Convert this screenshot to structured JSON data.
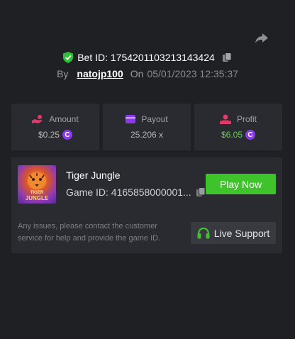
{
  "bet": {
    "id_text": "Bet ID: 1754201103213143424",
    "by_label": "By",
    "user": "natojp100",
    "on_label": "On",
    "date": "05/01/2023 12:35:37"
  },
  "stats": [
    {
      "label": "Amount",
      "value": "$0.25",
      "icon": "amount-icon",
      "value_color": "#b5b6ba"
    },
    {
      "label": "Payout",
      "value": "25.206 x",
      "icon": "payout-icon",
      "value_color": "#b5b6ba"
    },
    {
      "label": "Profit",
      "value": "$6.05",
      "icon": "profit-icon",
      "value_color": "#5fd14a"
    }
  ],
  "coin_symbol": "C",
  "game": {
    "thumb_line1": "TIGER",
    "thumb_line2": "JUNGLE",
    "title": "Tiger Jungle",
    "game_id_text": "Game ID: 4165858000001...",
    "play_label": "Play Now",
    "issue_text": "Any issues, please contact the customer service for help and provide the game ID.",
    "support_label": "Live Support"
  },
  "colors": {
    "background": "#1f2024",
    "card": "#2a2b30",
    "play_button": "#3fc32a",
    "accent_purple": "#8a3ae8",
    "accent_pink": "#e0396a"
  }
}
